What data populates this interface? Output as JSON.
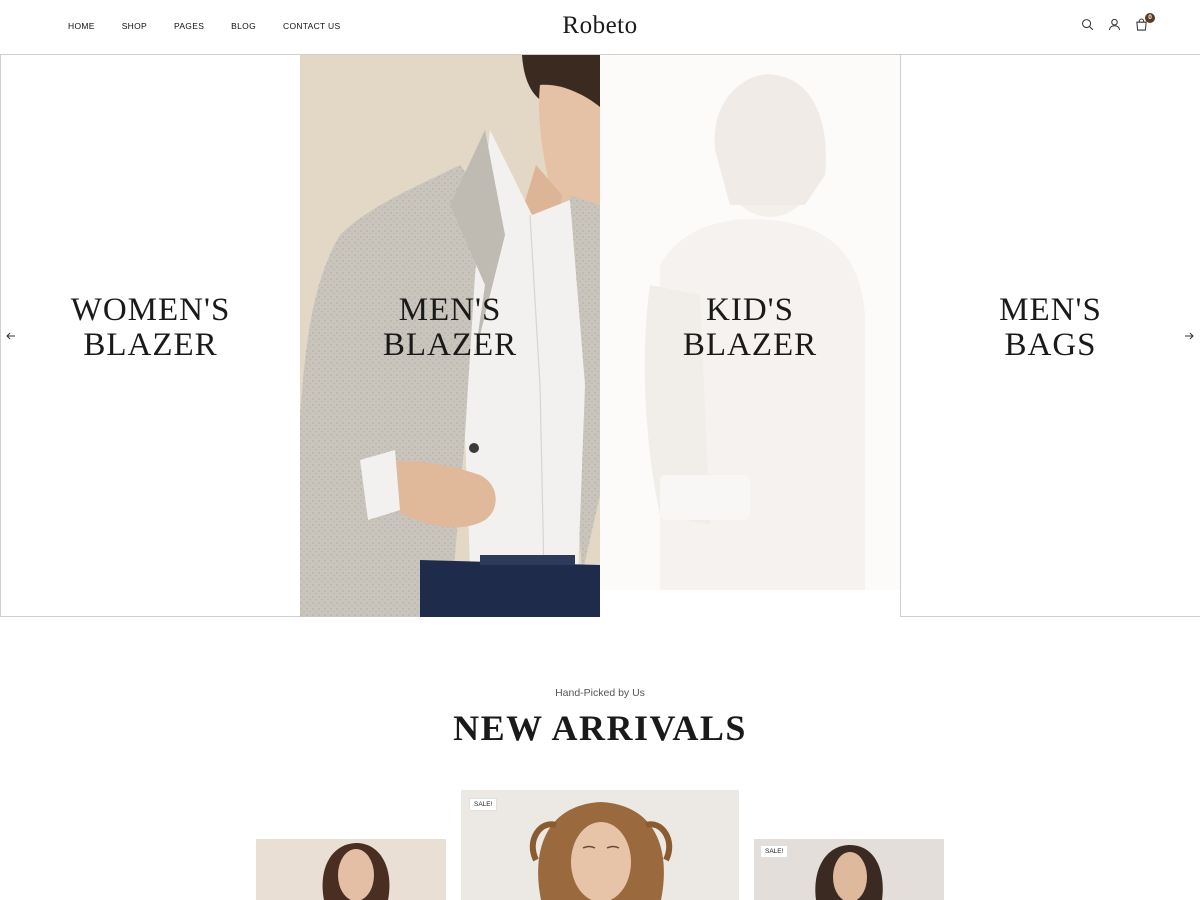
{
  "header": {
    "nav": [
      "HOME",
      "SHOP",
      "PAGES",
      "BLOG",
      "CONTACT US"
    ],
    "logo": "Robeto",
    "cart_count": "0",
    "icons": [
      "search-icon",
      "user-icon",
      "cart-icon"
    ]
  },
  "hero": {
    "panels": [
      {
        "line1": "WOMEN'S",
        "line2": "BLAZER"
      },
      {
        "line1": "MEN'S",
        "line2": "BLAZER"
      },
      {
        "line1": "KID'S",
        "line2": "BLAZER"
      },
      {
        "line1": "MEN'S",
        "line2": "BAGS"
      }
    ],
    "arrows": [
      "arrow-left-icon",
      "arrow-right-icon"
    ]
  },
  "arrivals": {
    "eyebrow": "Hand-Picked by Us",
    "title": "NEW ARRIVALS",
    "products": [
      {
        "badge": ""
      },
      {
        "badge": "SALE!"
      },
      {
        "badge": "SALE!"
      }
    ]
  },
  "colors": {
    "accent": "#5a3a22",
    "text": "#1a1a1a",
    "border": "#cfcfcf"
  }
}
